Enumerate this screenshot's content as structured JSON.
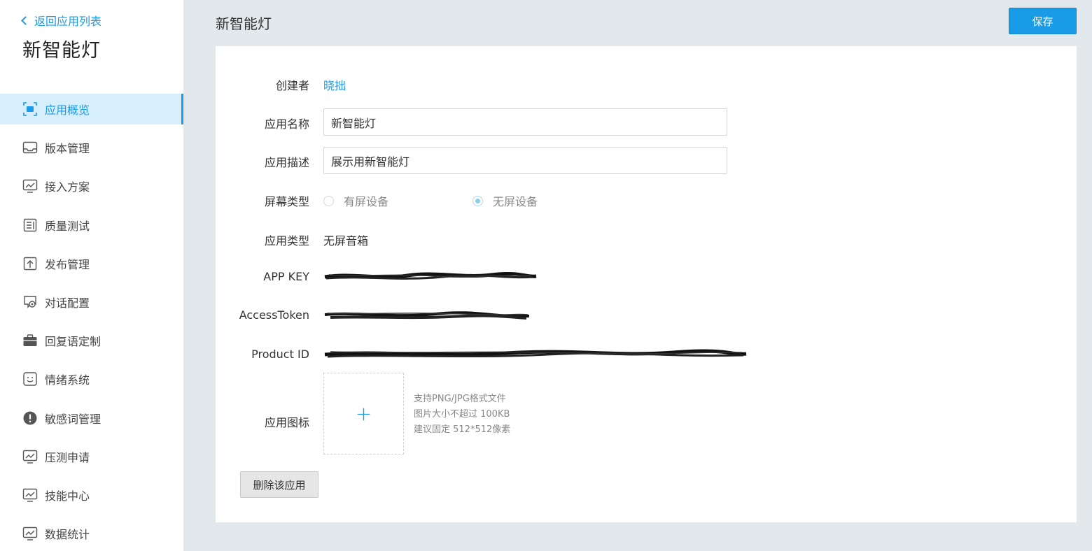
{
  "sidebar": {
    "back_label": "返回应用列表",
    "app_title": "新智能灯",
    "items": [
      {
        "label": "应用概览",
        "icon": "overview-icon"
      },
      {
        "label": "版本管理",
        "icon": "inbox-icon"
      },
      {
        "label": "接入方案",
        "icon": "monitor-chart-icon"
      },
      {
        "label": "质量测试",
        "icon": "document-icon"
      },
      {
        "label": "发布管理",
        "icon": "upload-icon"
      },
      {
        "label": "对话配置",
        "icon": "chat-gear-icon"
      },
      {
        "label": "回复语定制",
        "icon": "briefcase-icon"
      },
      {
        "label": "情绪系统",
        "icon": "smile-icon"
      },
      {
        "label": "敏感词管理",
        "icon": "alert-icon"
      },
      {
        "label": "压测申请",
        "icon": "monitor-chart-icon"
      },
      {
        "label": "技能中心",
        "icon": "monitor-chart-icon"
      },
      {
        "label": "数据统计",
        "icon": "monitor-chart-icon"
      }
    ],
    "active_index": 0
  },
  "header": {
    "title": "新智能灯",
    "save_label": "保存"
  },
  "form": {
    "creator_label": "创建者",
    "creator_value": "晓拙",
    "name_label": "应用名称",
    "name_value": "新智能灯",
    "desc_label": "应用描述",
    "desc_value": "展示用新智能灯",
    "screen_label": "屏幕类型",
    "screen_options": [
      "有屏设备",
      "无屏设备"
    ],
    "screen_selected": "无屏设备",
    "type_label": "应用类型",
    "type_value": "无屏音箱",
    "appkey_label": "APP KEY",
    "token_label": "AccessToken",
    "product_label": "Product ID",
    "icon_label": "应用图标",
    "upload_hints": [
      "支持PNG/JPG格式文件",
      "图片大小不超过 100KB",
      "建议固定 512*512像素"
    ],
    "delete_label": "删除该应用"
  },
  "colors": {
    "accent": "#1a9be6",
    "active_bg": "#d7eefb",
    "page_bg": "#e3e8ec"
  }
}
